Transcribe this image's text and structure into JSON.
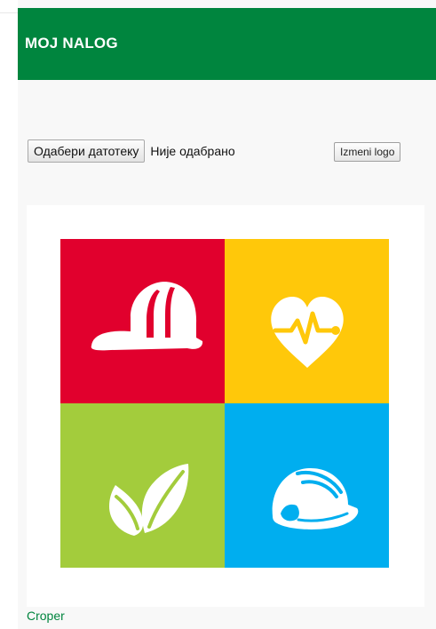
{
  "header": {
    "title": "MOJ NALOG"
  },
  "upload": {
    "choose_file_label": "Одабери датотеку",
    "file_status": "Није одабрано",
    "edit_logo_label": "Izmeni logo"
  },
  "logo": {
    "tiles": [
      {
        "icon": "firefighter-helmet-icon",
        "color": "#e1002d"
      },
      {
        "icon": "heart-pulse-icon",
        "color": "#ffc80a"
      },
      {
        "icon": "leaves-icon",
        "color": "#a3cc3c"
      },
      {
        "icon": "hard-hat-icon",
        "color": "#00aeef"
      }
    ]
  },
  "footer": {
    "croper_label": "Croper"
  },
  "colors": {
    "header_bg": "#00853e",
    "link": "#00853e",
    "page_bg": "#f8f8f8"
  }
}
